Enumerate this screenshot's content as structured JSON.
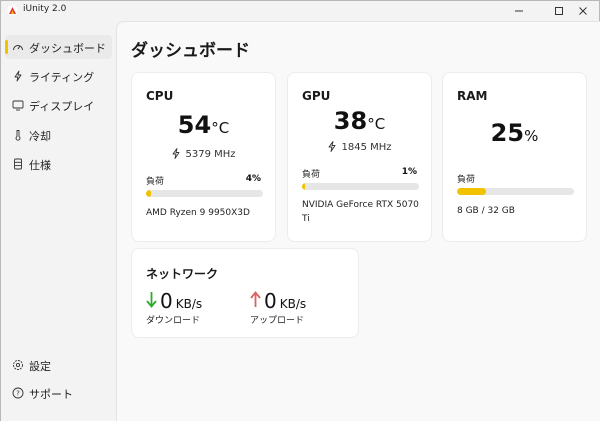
{
  "window": {
    "title": "iUnity 2.0"
  },
  "sidebar": {
    "items": [
      {
        "label": "ダッシュボード",
        "icon": "gauge-icon",
        "active": true
      },
      {
        "label": "ライティング",
        "icon": "lightning-icon"
      },
      {
        "label": "ディスプレイ",
        "icon": "monitor-icon"
      },
      {
        "label": "冷却",
        "icon": "thermometer-icon"
      },
      {
        "label": "仕様",
        "icon": "database-icon"
      }
    ],
    "bottom": [
      {
        "label": "設定",
        "icon": "gear-icon"
      },
      {
        "label": "サポート",
        "icon": "help-icon"
      }
    ]
  },
  "page": {
    "title": "ダッシュボード"
  },
  "cpu": {
    "title": "CPU",
    "temp": "54",
    "temp_unit": "°C",
    "clock": "5379 MHz",
    "load_label": "負荷",
    "load_pct": "4%",
    "load_value": 4,
    "model": "AMD Ryzen 9 9950X3D"
  },
  "gpu": {
    "title": "GPU",
    "temp": "38",
    "temp_unit": "°C",
    "clock": "1845 MHz",
    "load_label": "負荷",
    "load_pct": "1%",
    "load_value": 1,
    "model": "NVIDIA GeForce RTX 5070 Ti"
  },
  "ram": {
    "title": "RAM",
    "usage": "25",
    "usage_unit": "%",
    "load_label": "負荷",
    "load_value": 25,
    "detail": "8 GB / 32 GB"
  },
  "network": {
    "title": "ネットワーク",
    "down_value": "0",
    "down_unit": "KB/s",
    "down_label": "ダウンロード",
    "up_value": "0",
    "up_unit": "KB/s",
    "up_label": "アップロード"
  },
  "colors": {
    "accent": "#f2c200",
    "download": "#2eaa2e",
    "upload": "#e06060"
  }
}
